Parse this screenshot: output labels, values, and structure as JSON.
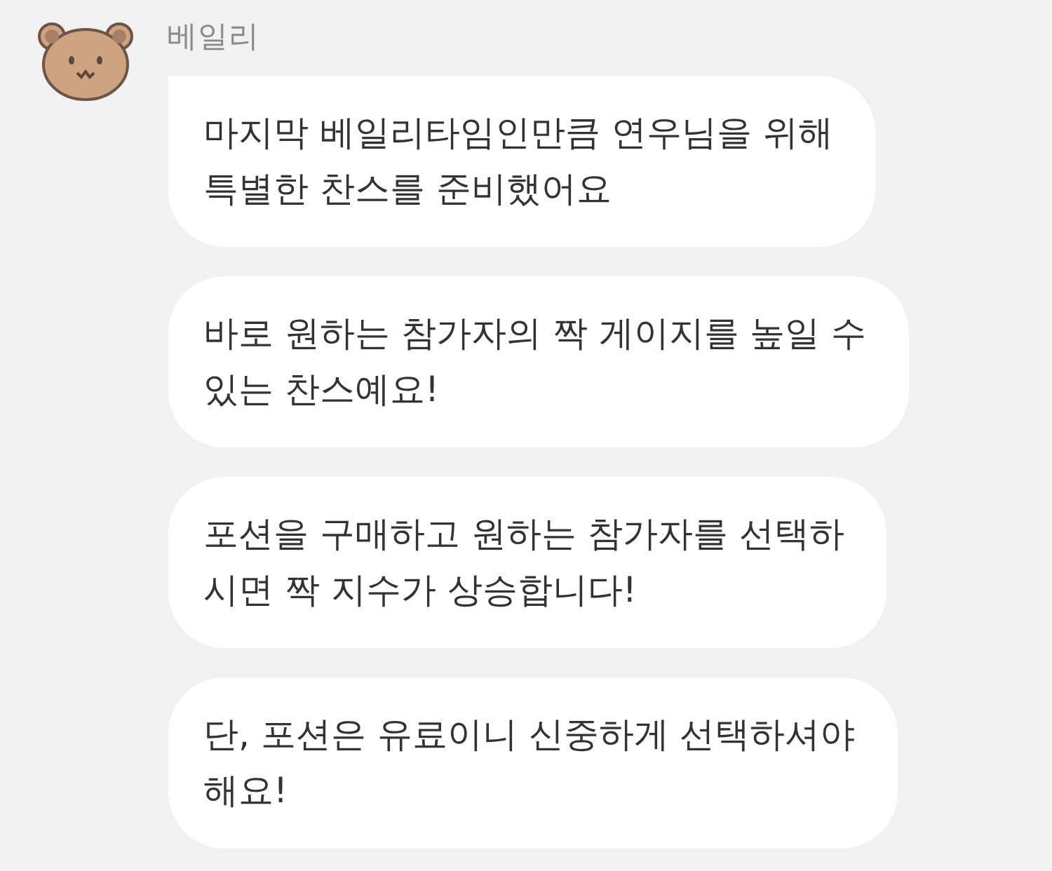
{
  "sender": {
    "name": "베일리"
  },
  "messages": [
    {
      "text": "마지막 베일리타임인만큼 연우님을 위해\n특별한 찬스를 준비했어요",
      "first": true
    },
    {
      "text": "바로 원하는 참가자의 짝 게이지를 높일 수\n있는 찬스예요!",
      "first": false
    },
    {
      "text": "포션을 구매하고 원하는 참가자를 선택하\n시면 짝 지수가 상승합니다!",
      "first": false
    },
    {
      "text": "단, 포션은 유료이니 신중하게 선택하셔야\n해요!",
      "first": false
    }
  ]
}
